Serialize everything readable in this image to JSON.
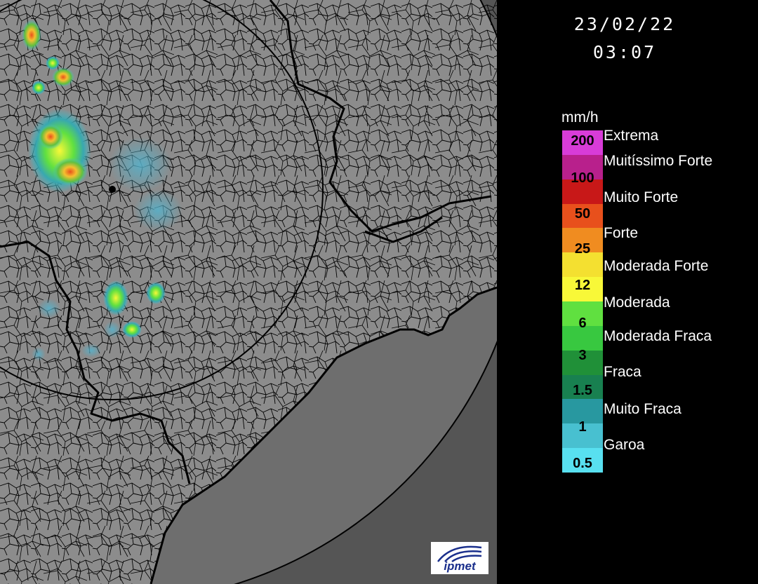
{
  "timestamp": {
    "date": "23/02/22",
    "time": "03:07"
  },
  "legend": {
    "unit": "mm/h",
    "values": [
      "200",
      "100",
      "50",
      "25",
      "12",
      "6",
      "3",
      "1.5",
      "1",
      "0.5"
    ],
    "categories": [
      "Extrema",
      "Muitíssimo Forte",
      "Muito Forte",
      "Forte",
      "Moderada Forte",
      "Moderada",
      "Moderada Fraca",
      "Fraca",
      "Muito Fraca",
      "Garoa"
    ],
    "colors": [
      "#d83cd8",
      "#b8208c",
      "#c81818",
      "#e8501c",
      "#f08c20",
      "#f4e030",
      "#f8f838",
      "#60e040",
      "#38c840",
      "#209038",
      "#188050",
      "#2898a0",
      "#48c0d0",
      "#58e0f0"
    ]
  },
  "logo": {
    "text": "ipmet"
  },
  "map": {
    "colors": {
      "land": "#8c8c8c",
      "ocean": "#6e6e6e",
      "boundary": "#000000",
      "range_ring": "#000000"
    },
    "precipitation_cells": [
      {
        "area": "northwest",
        "intensity": "Moderada"
      },
      {
        "area": "west",
        "intensity": "Moderada Forte"
      },
      {
        "area": "center-south",
        "intensity": "Moderada"
      }
    ]
  }
}
